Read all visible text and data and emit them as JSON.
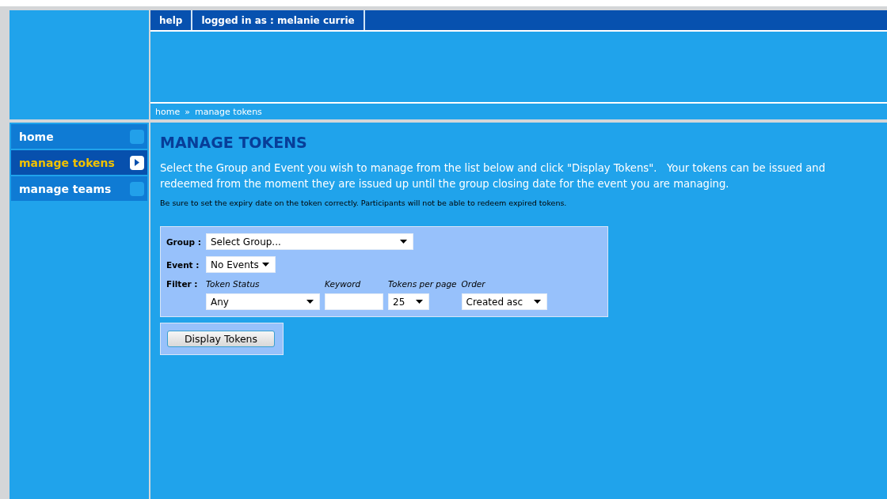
{
  "top_bar": {
    "links": [
      "help",
      "logged in as : melanie currie"
    ]
  },
  "breadcrumb": {
    "items": [
      "home",
      "manage tokens"
    ],
    "separator": "»"
  },
  "sidebar": {
    "items": [
      {
        "label": "home",
        "selected": false
      },
      {
        "label": "manage tokens",
        "selected": true
      },
      {
        "label": "manage teams",
        "selected": false
      }
    ]
  },
  "page": {
    "title": "MANAGE TOKENS",
    "intro": "Select the Group and Event you wish to manage from the list below and click \"Display Tokens\".   Your tokens can be issued and redeemed from the moment they are issued up until the group closing date for the event you are managing.",
    "note": "Be sure to set the expiry date on the token correctly.  Participants will not be able to redeem expired tokens."
  },
  "form": {
    "group": {
      "label": "Group :",
      "value": "Select Group..."
    },
    "event": {
      "label": "Event :",
      "value": "No Events"
    },
    "filter": {
      "label": "Filter :",
      "fields": [
        {
          "kind": "select",
          "label": "Token Status",
          "value": "Any"
        },
        {
          "kind": "text",
          "label": "Keyword"
        },
        {
          "kind": "select",
          "label": "Tokens per page",
          "value": "25"
        },
        {
          "kind": "select",
          "label": "Order",
          "value": "Created asc"
        }
      ]
    },
    "button": "Display Tokens"
  }
}
